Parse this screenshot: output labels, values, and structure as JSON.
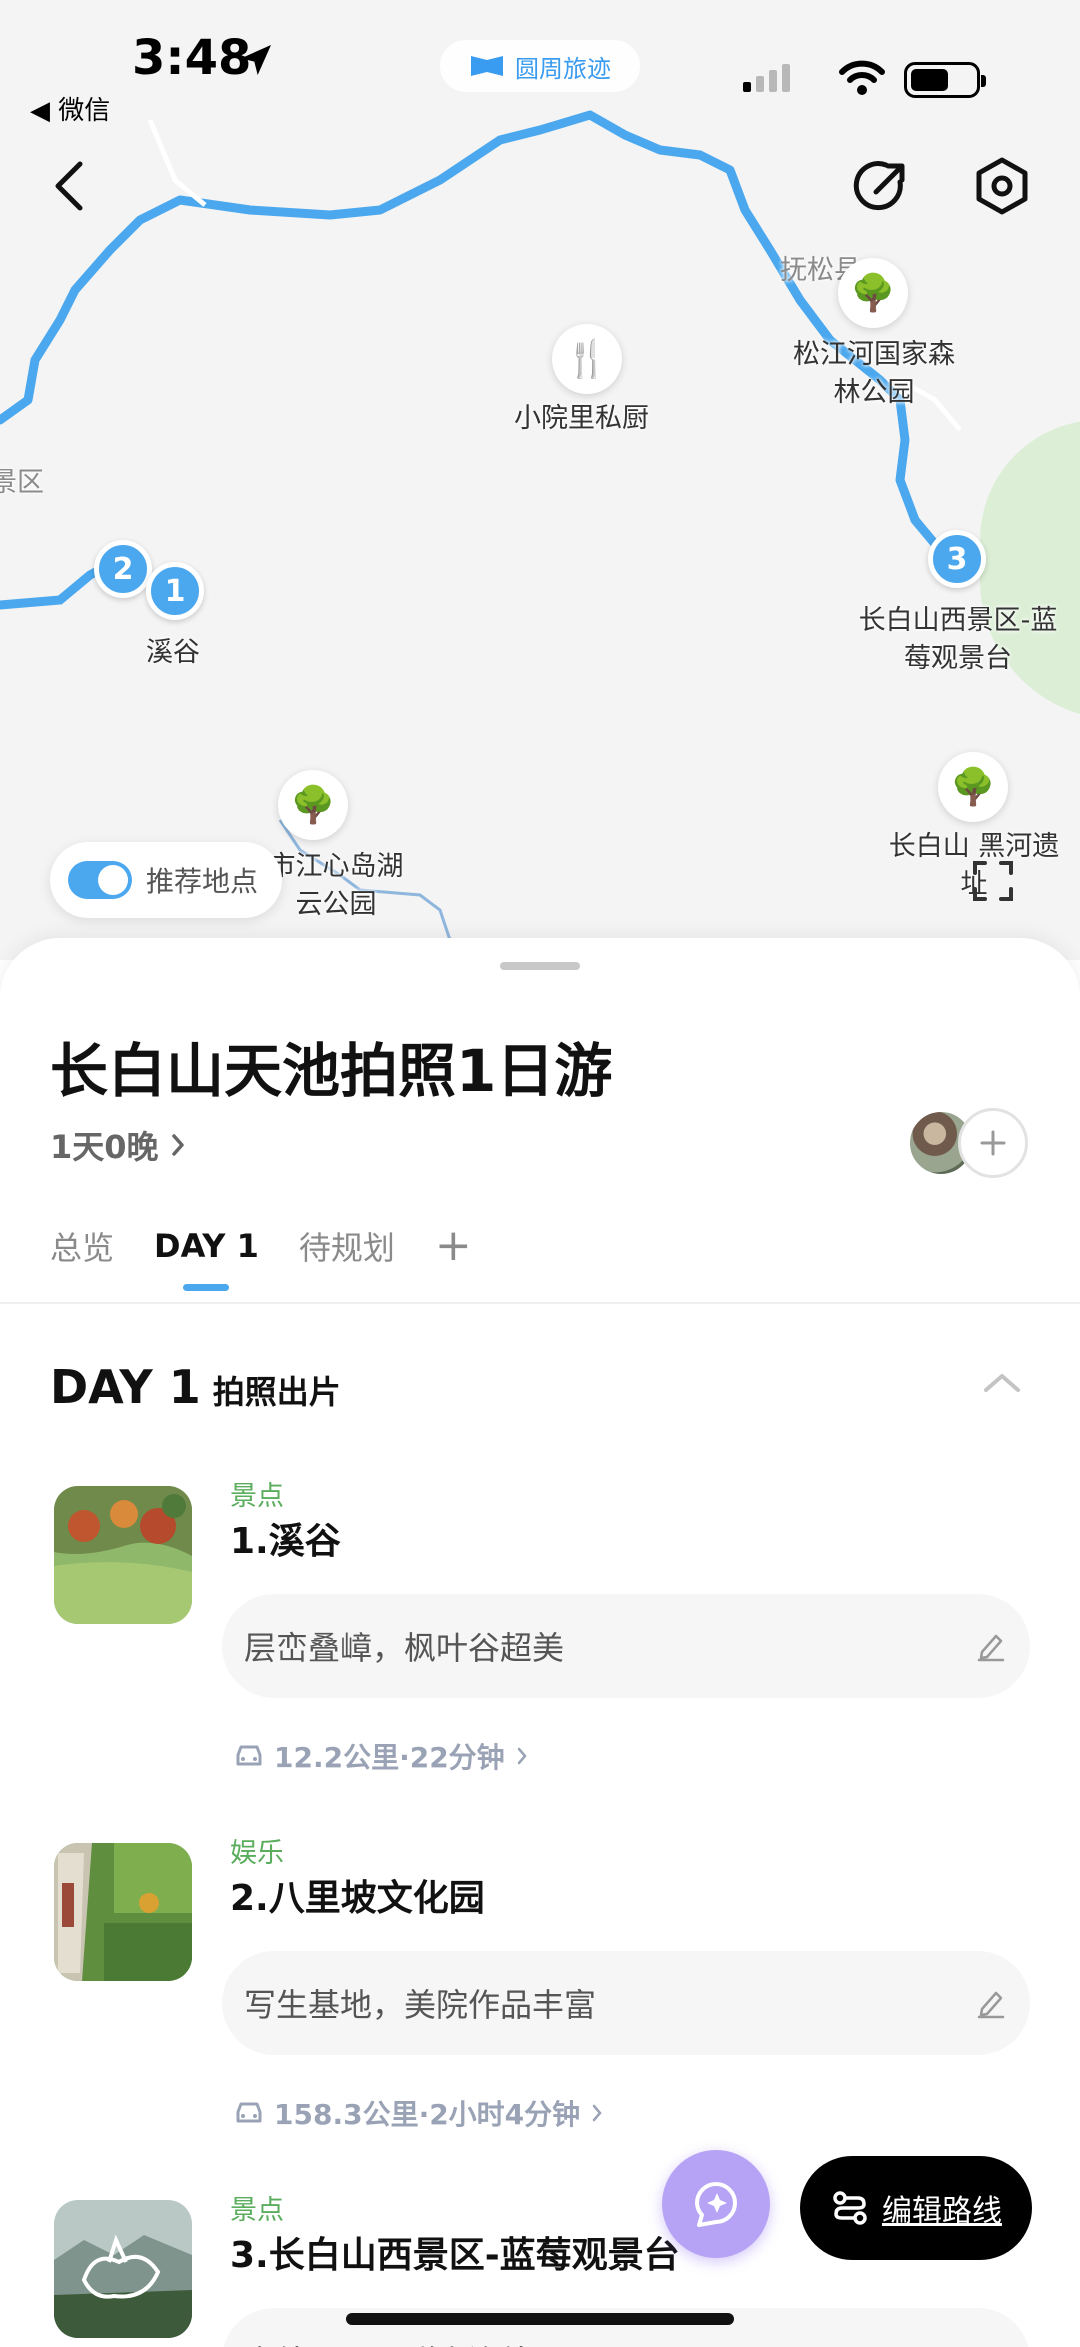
{
  "status_bar": {
    "time": "3:48",
    "back_app": "◀ 微信",
    "app_pill": "圆周旅迹"
  },
  "map": {
    "labels": {
      "songhua": "抚松县",
      "songjiang": "松江河国家森林公园",
      "kitchen": "小院里私厨",
      "xigu": "溪谷",
      "west": "长白山西景区-蓝莓观景台",
      "jiangxin": "市江心岛湖云公园",
      "heihe": "长白山 黑河遗址",
      "edge_left": "景区"
    },
    "pins": [
      "1",
      "2",
      "3"
    ],
    "toggle_label": "推荐地点"
  },
  "trip": {
    "title": "长白山天池拍照1日游",
    "duration": "1天0晚"
  },
  "tabs": [
    "总览",
    "DAY 1",
    "待规划"
  ],
  "tab_add": "+",
  "day": {
    "label": "DAY 1",
    "theme": "拍照出片"
  },
  "items": [
    {
      "category": "景点",
      "name": "1.溪谷",
      "note": "层峦叠嶂，枫叶谷超美"
    },
    {
      "category": "娱乐",
      "name": "2.八里坡文化园",
      "note": "写生基地，美院作品丰富"
    },
    {
      "category": "景点",
      "name": "3.长白山西景区-蓝莓观景台",
      "note": "高处观景，群山连绵"
    }
  ],
  "transport": [
    {
      "text": "12.2公里·22分钟"
    },
    {
      "text": "158.3公里·2小时4分钟"
    }
  ],
  "actions": {
    "edit_route": "编辑路线"
  },
  "colors": {
    "accent": "#4ba8ee",
    "category": "#5aad5c",
    "ai": "#b6a3f5"
  }
}
